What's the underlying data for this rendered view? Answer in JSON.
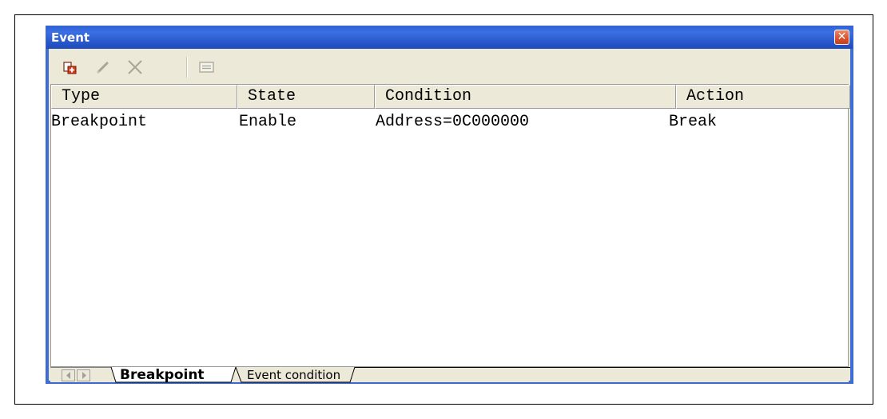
{
  "window": {
    "title": "Event"
  },
  "toolbar": {
    "buttons": [
      {
        "name": "add-event",
        "icon": "add-event-icon",
        "enabled": true
      },
      {
        "name": "edit-event",
        "icon": "pencil-icon",
        "enabled": false
      },
      {
        "name": "delete-event",
        "icon": "delete-x-icon",
        "enabled": false
      },
      {
        "name": "properties",
        "icon": "properties-icon",
        "enabled": false
      }
    ]
  },
  "table": {
    "columns": [
      "Type",
      "State",
      "Condition",
      "Action"
    ],
    "rows": [
      [
        "Breakpoint",
        "Enable",
        "Address=0C000000",
        "Break"
      ]
    ]
  },
  "tabs": {
    "items": [
      {
        "label": "Breakpoint",
        "active": true
      },
      {
        "label": "Event condition",
        "active": false
      }
    ]
  },
  "colors": {
    "titlebar": "#2f62d8",
    "window_face": "#ece9d8",
    "close_button": "#d9502c"
  }
}
